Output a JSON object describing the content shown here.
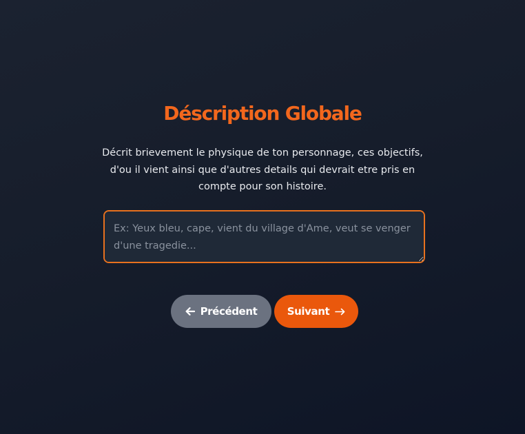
{
  "page": {
    "title": "Déscription Globale",
    "description": "Décrit brievement le physique de ton personnage, ces objectifs, d'ou il vient ainsi que d'autres details qui devrait etre pris en compte pour son histoire."
  },
  "input": {
    "value": "",
    "placeholder": "Ex: Yeux bleu, cape, vient du village d'Ame, veut se venger d'une tragedie..."
  },
  "buttons": {
    "previous_label": "Précédent",
    "previous_icon": "arrow-left-icon",
    "next_label": "Suivant",
    "next_icon": "arrow-right-icon"
  },
  "colors": {
    "accent": "#f2671d",
    "button_primary": "#ea580c",
    "button_secondary": "#6b7280",
    "background": "#161d2b",
    "input_background": "#1f2937"
  }
}
